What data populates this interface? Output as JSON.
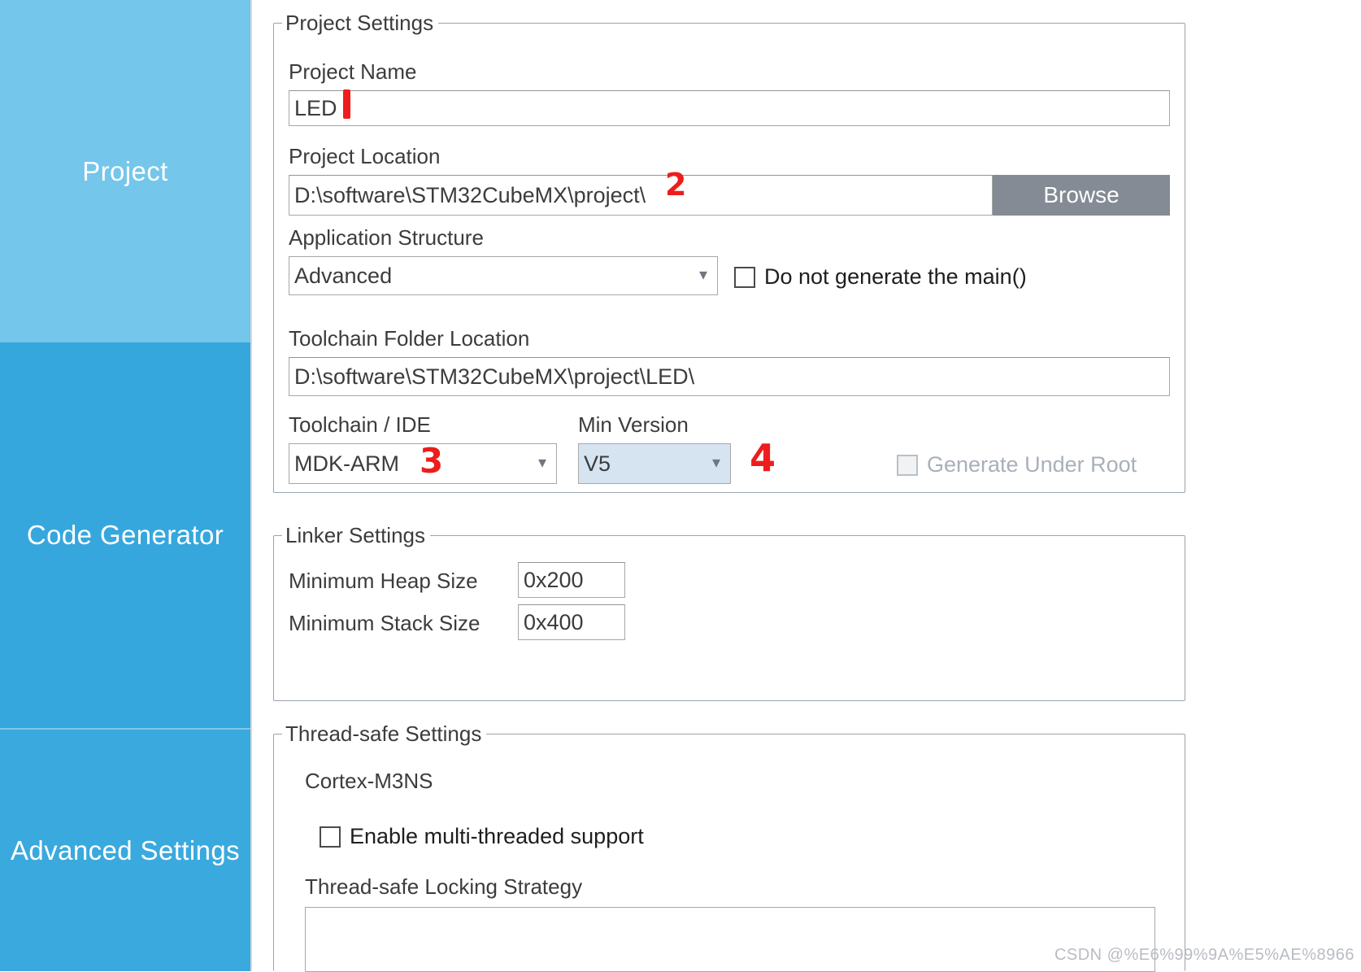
{
  "sidebar": {
    "items": [
      {
        "id": "project",
        "label": "Project",
        "color": "#74c6ea",
        "selected": false
      },
      {
        "id": "codegen",
        "label": "Code Generator",
        "color": "#36a7dd",
        "selected": true
      },
      {
        "id": "advanced",
        "label": "Advanced Settings",
        "color": "#3aa9de",
        "selected": false
      }
    ]
  },
  "project_settings": {
    "group_title": "Project Settings",
    "project_name_label": "Project Name",
    "project_name_value": "LED",
    "project_location_label": "Project Location",
    "project_location_value": "D:\\software\\STM32CubeMX\\project\\",
    "browse_label": "Browse",
    "application_structure_label": "Application Structure",
    "application_structure_value": "Advanced",
    "do_not_generate_main_label": "Do not generate the main()",
    "do_not_generate_main_checked": false,
    "toolchain_folder_label": "Toolchain Folder Location",
    "toolchain_folder_value": "D:\\software\\STM32CubeMX\\project\\LED\\",
    "toolchain_ide_label": "Toolchain / IDE",
    "toolchain_ide_value": "MDK-ARM",
    "min_version_label": "Min Version",
    "min_version_value": "V5",
    "generate_under_root_label": "Generate Under Root",
    "generate_under_root_checked": false,
    "generate_under_root_disabled": true
  },
  "linker_settings": {
    "group_title": "Linker Settings",
    "min_heap_label": "Minimum Heap Size",
    "min_heap_value": "0x200",
    "min_stack_label": "Minimum Stack Size",
    "min_stack_value": "0x400"
  },
  "thread_safe_settings": {
    "group_title": "Thread-safe Settings",
    "core_label": "Cortex-M3NS",
    "enable_multithread_label": "Enable multi-threaded support",
    "enable_multithread_checked": false,
    "locking_strategy_label": "Thread-safe Locking Strategy",
    "locking_strategy_value": ""
  },
  "annotations": {
    "mark1": "",
    "mark2": "2",
    "mark3": "3",
    "mark4": "4"
  },
  "watermark": "CSDN @%E6%99%9A%E5%AE%8966",
  "colors": {
    "sidebar_light": "#74c6ea",
    "sidebar_selected": "#36a7dd",
    "sidebar_bottom": "#3aa9de",
    "button_gray": "#848b95",
    "highlight_blue": "#d6e4f2",
    "annotation_red": "#ee1c1c",
    "text": "#3c3c3c"
  }
}
